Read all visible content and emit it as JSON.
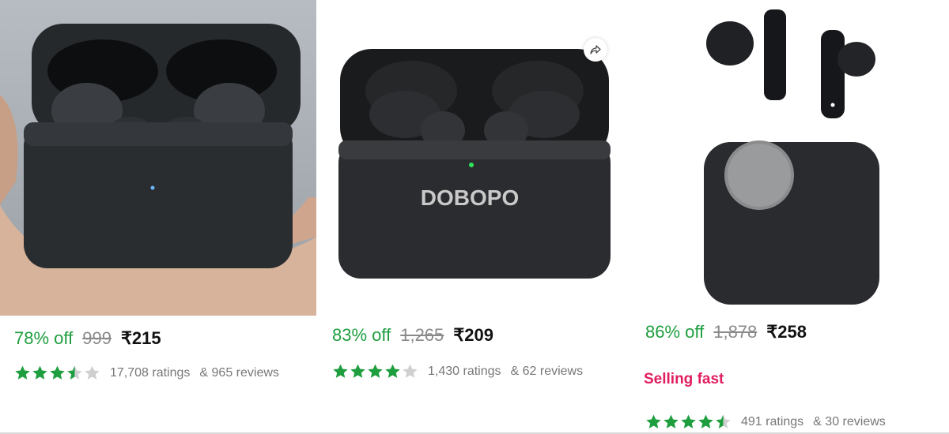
{
  "products": [
    {
      "discount": "78% off",
      "mrp": "999",
      "price": "₹215",
      "stars": 3.5,
      "ratings_text": "17,708 ratings",
      "reviews_text": "& 965 reviews"
    },
    {
      "brand": "DOBOPO",
      "discount": "83% off",
      "mrp": "1,265",
      "price": "₹209",
      "stars": 4,
      "ratings_text": "1,430 ratings",
      "reviews_text": "& 62 reviews"
    },
    {
      "discount": "86% off",
      "mrp": "1,878",
      "price": "₹258",
      "badge": "Selling fast",
      "stars": 4.5,
      "ratings_text": "491 ratings",
      "reviews_text": "& 30 reviews"
    }
  ],
  "colors": {
    "accent_green": "#1e9e3e",
    "badge_pink": "#e11d5e",
    "star_empty": "#d0d0d0"
  }
}
